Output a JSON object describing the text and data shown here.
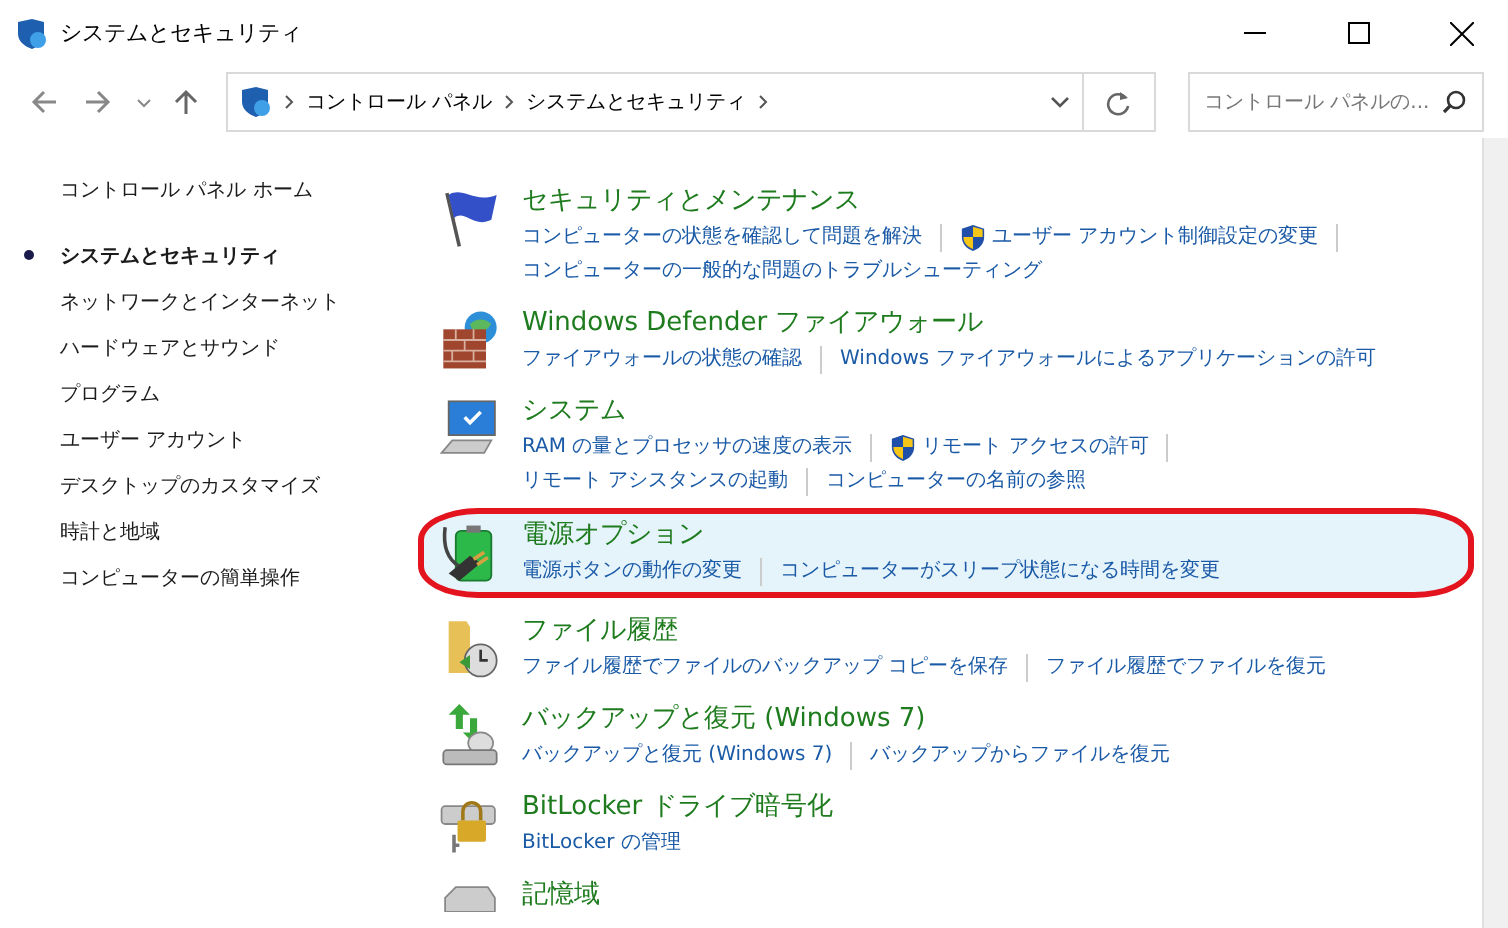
{
  "window": {
    "title": "システムとセキュリティ"
  },
  "address_bar": {
    "crumbs": [
      "コントロール パネル",
      "システムとセキュリティ"
    ]
  },
  "search": {
    "placeholder": "コントロール パネルの..."
  },
  "sidebar": {
    "items": [
      {
        "label": "コントロール パネル ホーム",
        "selected": false
      },
      {
        "label": "システムとセキュリティ",
        "selected": true
      },
      {
        "label": "ネットワークとインターネット",
        "selected": false
      },
      {
        "label": "ハードウェアとサウンド",
        "selected": false
      },
      {
        "label": "プログラム",
        "selected": false
      },
      {
        "label": "ユーザー アカウント",
        "selected": false
      },
      {
        "label": "デスクトップのカスタマイズ",
        "selected": false
      },
      {
        "label": "時計と地域",
        "selected": false
      },
      {
        "label": "コンピューターの簡単操作",
        "selected": false
      }
    ]
  },
  "categories": [
    {
      "title": "セキュリティとメンテナンス",
      "selected": false,
      "circled": false,
      "lines": [
        [
          {
            "label": "コンピューターの状態を確認して問題を解決",
            "shield": false
          },
          {
            "label": "ユーザー アカウント制御設定の変更",
            "shield": true
          }
        ],
        [
          {
            "label": "コンピューターの一般的な問題のトラブルシューティング",
            "shield": false
          }
        ]
      ]
    },
    {
      "title": "Windows Defender ファイアウォール",
      "selected": false,
      "circled": false,
      "lines": [
        [
          {
            "label": "ファイアウォールの状態の確認",
            "shield": false
          },
          {
            "label": "Windows ファイアウォールによるアプリケーションの許可",
            "shield": false
          }
        ]
      ]
    },
    {
      "title": "システム",
      "selected": false,
      "circled": false,
      "lines": [
        [
          {
            "label": "RAM の量とプロセッサの速度の表示",
            "shield": false
          },
          {
            "label": "リモート アクセスの許可",
            "shield": true
          }
        ],
        [
          {
            "label": "リモート アシスタンスの起動",
            "shield": false
          },
          {
            "label": "コンピューターの名前の参照",
            "shield": false
          }
        ]
      ]
    },
    {
      "title": "電源オプション",
      "selected": true,
      "circled": true,
      "lines": [
        [
          {
            "label": "電源ボタンの動作の変更",
            "shield": false
          },
          {
            "label": "コンピューターがスリープ状態になる時間を変更",
            "shield": false
          }
        ]
      ]
    },
    {
      "title": "ファイル履歴",
      "selected": false,
      "circled": false,
      "lines": [
        [
          {
            "label": "ファイル履歴でファイルのバックアップ コピーを保存",
            "shield": false
          },
          {
            "label": "ファイル履歴でファイルを復元",
            "shield": false
          }
        ]
      ]
    },
    {
      "title": "バックアップと復元 (Windows 7)",
      "selected": false,
      "circled": false,
      "lines": [
        [
          {
            "label": "バックアップと復元 (Windows 7)",
            "shield": false
          },
          {
            "label": "バックアップからファイルを復元",
            "shield": false
          }
        ]
      ]
    },
    {
      "title": "BitLocker ドライブ暗号化",
      "selected": false,
      "circled": false,
      "lines": [
        [
          {
            "label": "BitLocker の管理",
            "shield": false
          }
        ]
      ]
    },
    {
      "title": "記憶域",
      "selected": false,
      "circled": false
    }
  ]
}
